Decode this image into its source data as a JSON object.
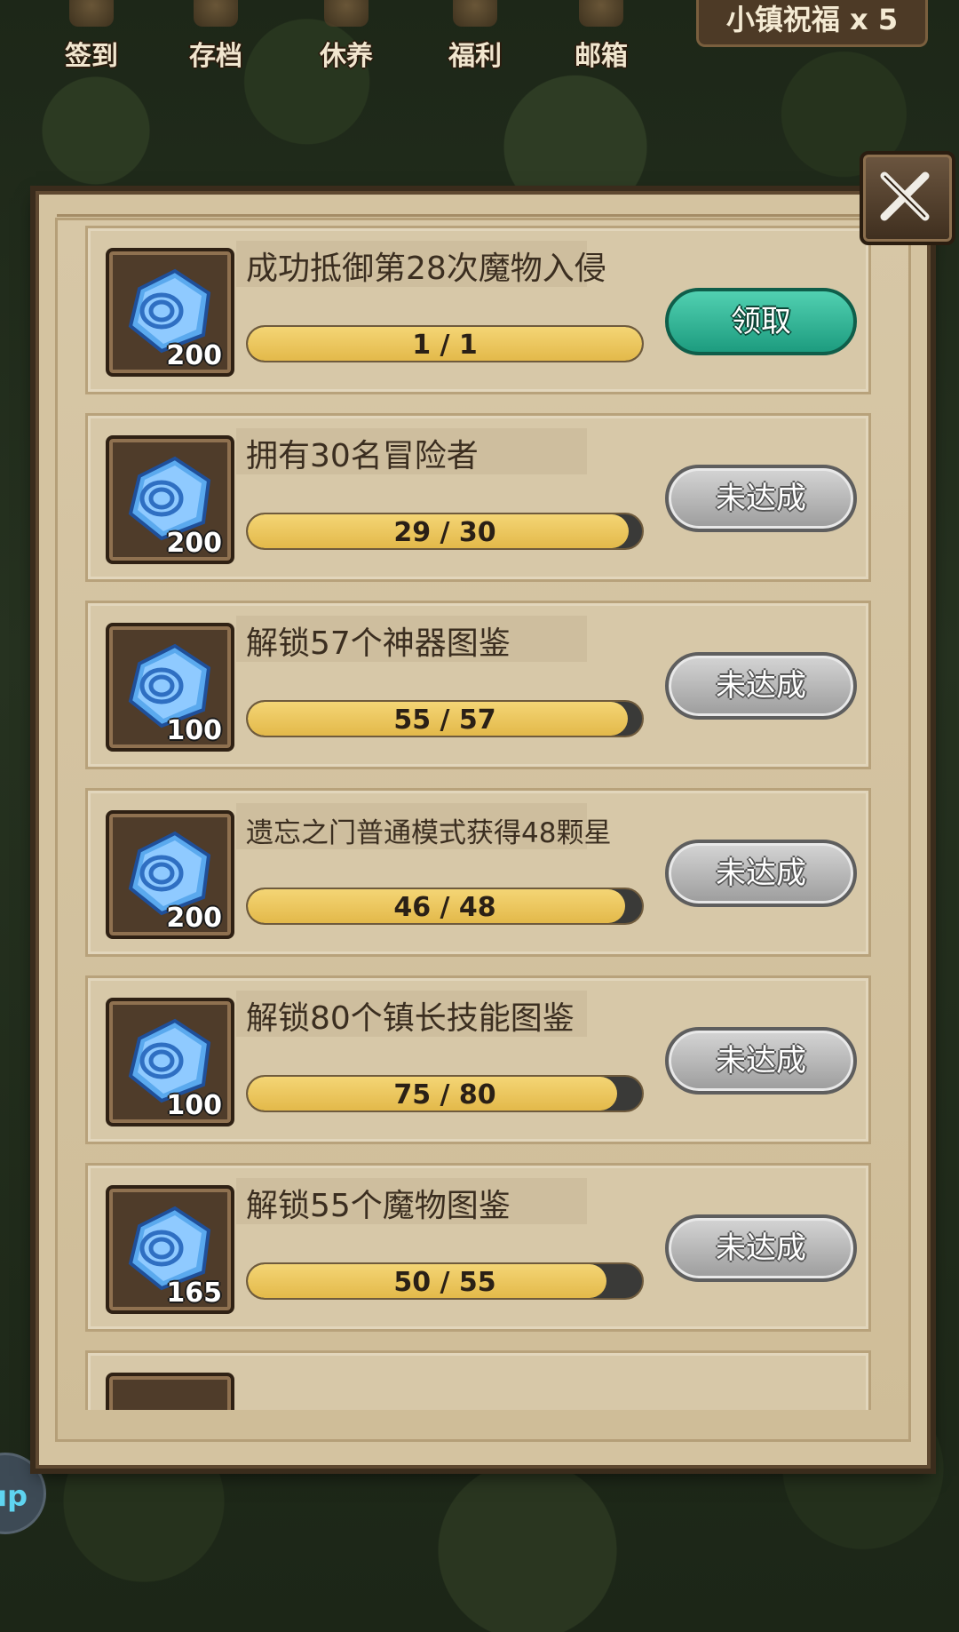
{
  "top_nav": {
    "items": [
      {
        "label": "签到",
        "icon": "sign-in-icon"
      },
      {
        "label": "存档",
        "icon": "save-icon"
      },
      {
        "label": "休养",
        "icon": "rest-icon"
      },
      {
        "label": "福利",
        "icon": "welfare-icon"
      },
      {
        "label": "邮箱",
        "icon": "mail-icon"
      }
    ],
    "blessing": "小镇祝福 x 5"
  },
  "side_button": {
    "label": "up"
  },
  "panel": {
    "close_icon": "crossed-swords-close-icon",
    "tasks": [
      {
        "title": "成功抵御第28次魔物入侵",
        "reward": "200",
        "progress_text": "1 / 1",
        "progress": 1.0,
        "button": "领取",
        "state": "claim"
      },
      {
        "title": "拥有30名冒险者",
        "reward": "200",
        "progress_text": "29 / 30",
        "progress": 0.9667,
        "button": "未达成",
        "state": "locked"
      },
      {
        "title": "解锁57个神器图鉴",
        "reward": "100",
        "progress_text": "55 / 57",
        "progress": 0.9649,
        "button": "未达成",
        "state": "locked"
      },
      {
        "title": "遗忘之门普通模式获得48颗星",
        "reward": "200",
        "progress_text": "46 / 48",
        "progress": 0.9583,
        "button": "未达成",
        "state": "locked"
      },
      {
        "title": "解锁80个镇长技能图鉴",
        "reward": "100",
        "progress_text": "75 / 80",
        "progress": 0.9375,
        "button": "未达成",
        "state": "locked"
      },
      {
        "title": "解锁55个魔物图鉴",
        "reward": "165",
        "progress_text": "50 / 55",
        "progress": 0.9091,
        "button": "未达成",
        "state": "locked"
      }
    ]
  },
  "colors": {
    "claim_button": "#2fb394",
    "locked_button": "#b8b8b8",
    "progress_fill": "#ecc85e",
    "panel": "#d4c3a0"
  }
}
